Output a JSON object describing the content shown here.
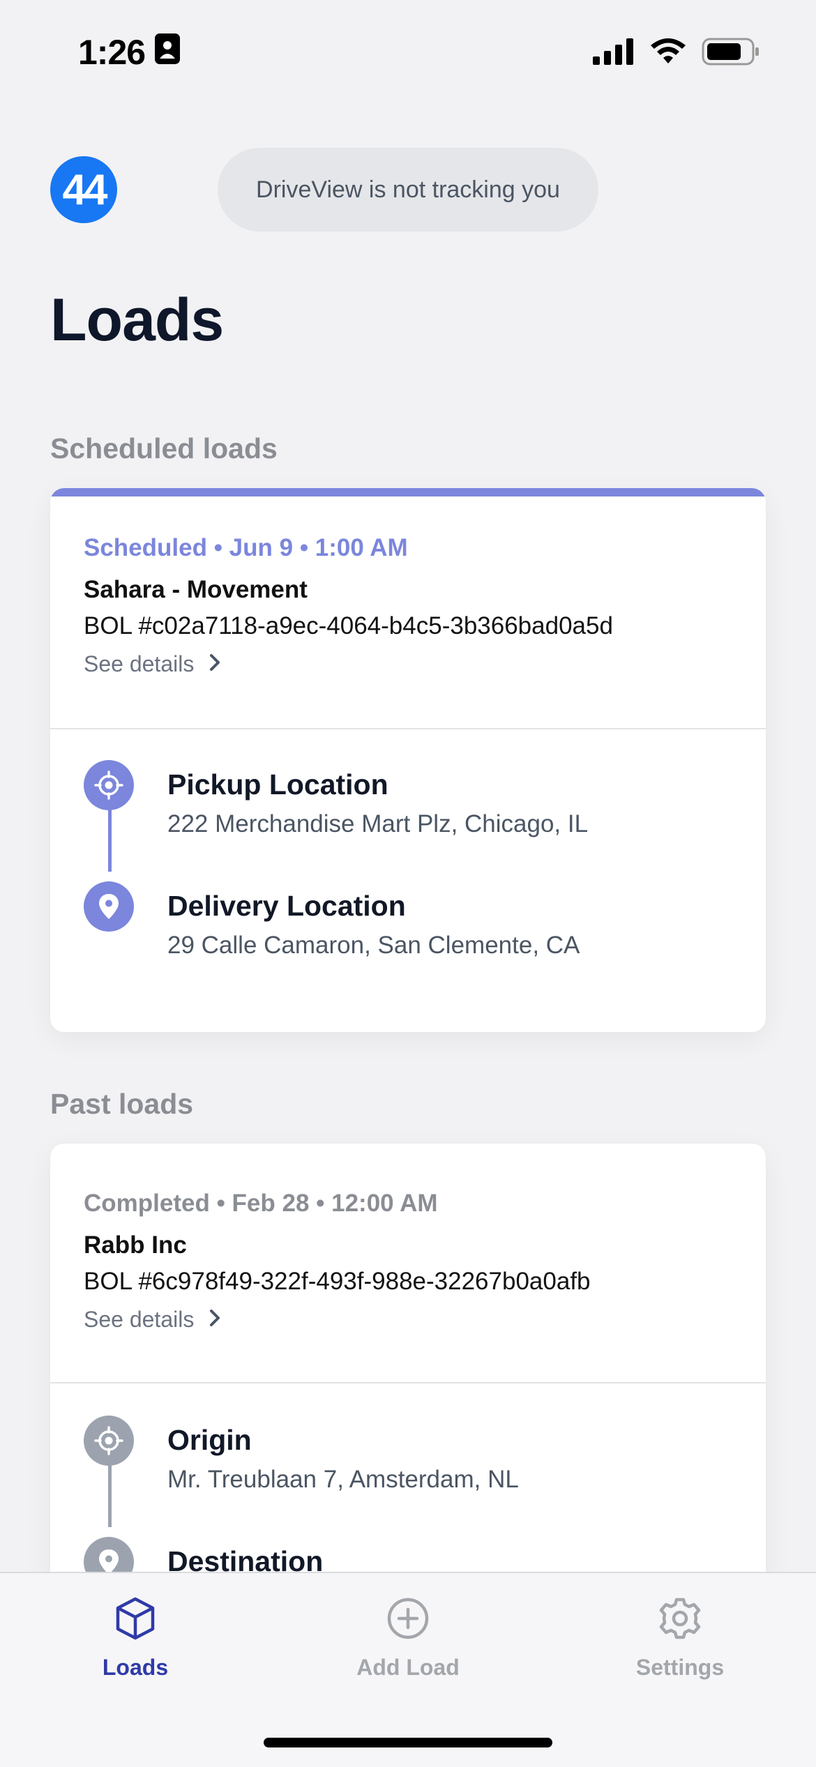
{
  "status_bar": {
    "time": "1:26"
  },
  "header": {
    "logo_text": "44",
    "tracking_status": "DriveView is not tracking you",
    "page_title": "Loads"
  },
  "scheduled": {
    "section_title": "Scheduled loads",
    "status_line": "Scheduled • Jun 9 • 1:00 AM",
    "shipper": "Sahara - Movement",
    "bol": "BOL #c02a7118-a9ec-4064-b4c5-3b366bad0a5d",
    "see_details": "See details",
    "stops": [
      {
        "title": "Pickup Location",
        "address": "222 Merchandise Mart Plz, Chicago, IL"
      },
      {
        "title": "Delivery Location",
        "address": "29 Calle Camaron, San Clemente, CA"
      }
    ],
    "accent_color": "#7b86dc"
  },
  "past": {
    "section_title": "Past loads",
    "status_line": "Completed • Feb 28 • 12:00 AM",
    "shipper": "Rabb Inc",
    "bol": "BOL #6c978f49-322f-493f-988e-32267b0a0afb",
    "see_details": "See details",
    "stops": [
      {
        "title": "Origin",
        "address": "Mr. Treublaan 7, Amsterdam, NL"
      },
      {
        "title": "Destination",
        "address": ""
      }
    ],
    "accent_color": "#9ca3af"
  },
  "tabs": [
    {
      "label": "Loads",
      "icon": "cube-icon",
      "active": true
    },
    {
      "label": "Add Load",
      "icon": "plus-circle-icon",
      "active": false
    },
    {
      "label": "Settings",
      "icon": "gear-icon",
      "active": false
    }
  ],
  "colors": {
    "active_tab": "#2f3aa8",
    "inactive_tab": "#a3a6ab"
  }
}
